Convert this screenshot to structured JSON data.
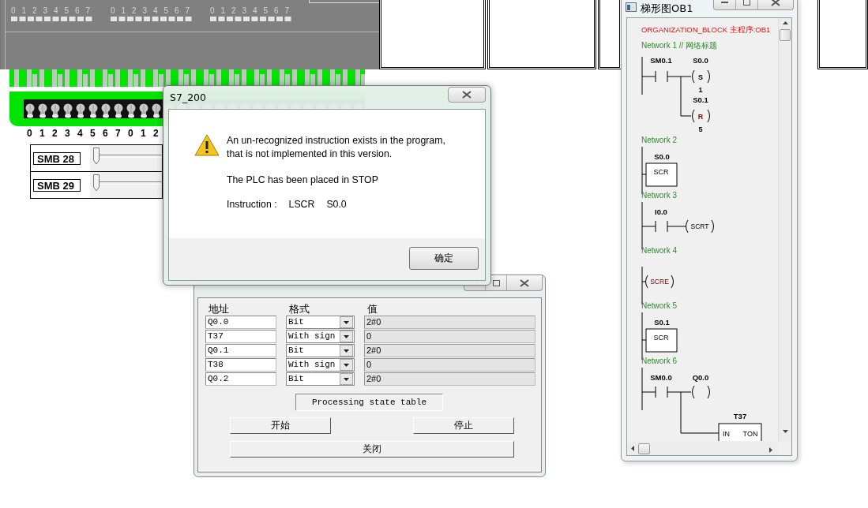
{
  "plc_panel": {
    "output_groups": [
      {
        "bits": [
          "0",
          "1",
          "2",
          "3",
          "4",
          "5",
          "6",
          "7"
        ]
      },
      {
        "bits": [
          "0",
          "1",
          "2",
          "3",
          "4",
          "5",
          "6",
          "7"
        ]
      },
      {
        "bits": [
          "0",
          "1",
          "2",
          "3",
          "4",
          "5",
          "6",
          "7"
        ]
      }
    ]
  },
  "input_strip": {
    "bulb_labels": [
      "0",
      "1",
      "2",
      "3",
      "4",
      "5",
      "6",
      "7",
      "0",
      "1",
      "2"
    ]
  },
  "sliders": [
    {
      "label": "SMB 28",
      "level": 0
    },
    {
      "label": "SMB 29",
      "level": 0
    }
  ],
  "alert": {
    "title": "S7_200",
    "message": "An un-recognized instruction exists in the program, that is not implemented in this version.",
    "status": "The PLC has been placed in STOP",
    "instruction_label": "Instruction :",
    "instruction": "LSCR",
    "operand": "S0.0",
    "ok_button": "确定"
  },
  "memory_table": {
    "columns": [
      "地址",
      "格式",
      "值"
    ],
    "rows": [
      {
        "address": "Q0.0",
        "format": "Bit",
        "value": "2#0"
      },
      {
        "address": "T37",
        "format": "With sign",
        "value": "0"
      },
      {
        "address": "Q0.1",
        "format": "Bit",
        "value": "2#0"
      },
      {
        "address": "T38",
        "format": "With sign",
        "value": "0"
      },
      {
        "address": "Q0.2",
        "format": "Bit",
        "value": "2#0"
      }
    ],
    "status": "Processing state table",
    "buttons": [
      "开始",
      "停止",
      "关闭"
    ]
  },
  "ladder": {
    "title": "梯形图OB1",
    "header": "ORGANIZATION_BLOCK 主程序:OB1",
    "networks": [
      {
        "title": "Network 1 // 网络标题",
        "kind": "set_reset",
        "contact": "SM0.1",
        "coils": [
          {
            "address": "S0.0",
            "op": "S",
            "count": "1"
          },
          {
            "address": "S0.1",
            "op": "R",
            "count": "5"
          }
        ]
      },
      {
        "title": "Network 2",
        "kind": "scr",
        "address": "S0.0",
        "box": "SCR"
      },
      {
        "title": "Network 3",
        "kind": "scrt",
        "contact": "I0.0",
        "coil": "SCRT"
      },
      {
        "title": "Network 4",
        "kind": "scre",
        "coil": "SCRE"
      },
      {
        "title": "Network 5",
        "kind": "scr",
        "address": "S0.1",
        "box": "SCR"
      },
      {
        "title": "Network 6",
        "kind": "timer",
        "contact": "SM0.0",
        "coil": "Q0.0",
        "timer": "T37",
        "input": "IN",
        "box": "TON"
      }
    ]
  }
}
